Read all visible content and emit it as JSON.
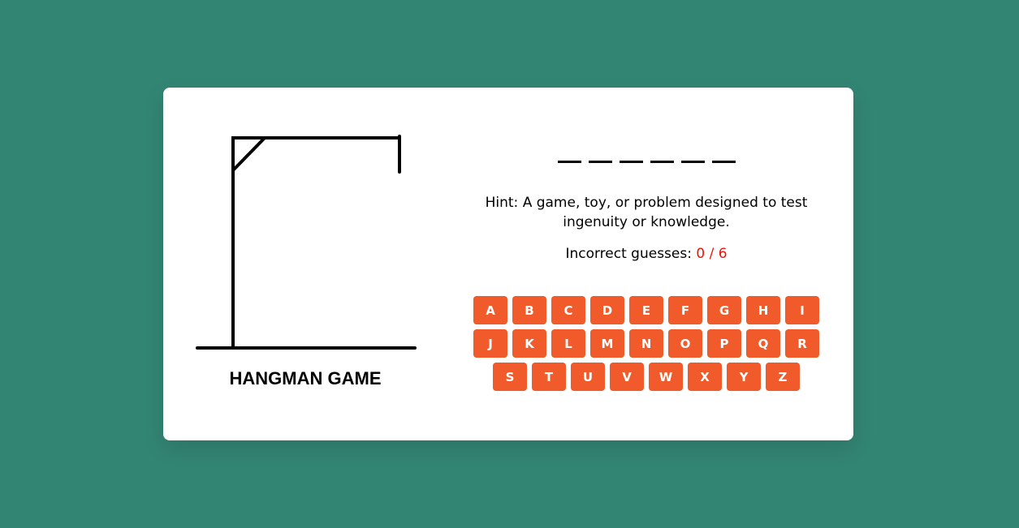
{
  "game": {
    "title": "HANGMAN GAME",
    "word_length": 6,
    "hint_label": "Hint:",
    "hint_text": "A game, toy, or problem designed to test ingenuity or knowledge.",
    "guesses_label": "Incorrect guesses:",
    "incorrect_count": "0 / 6"
  },
  "keyboard": {
    "rows": [
      [
        "A",
        "B",
        "C",
        "D",
        "E",
        "F",
        "G",
        "H",
        "I"
      ],
      [
        "J",
        "K",
        "L",
        "M",
        "N",
        "O",
        "P",
        "Q",
        "R"
      ],
      [
        "S",
        "T",
        "U",
        "V",
        "W",
        "X",
        "Y",
        "Z"
      ]
    ]
  },
  "colors": {
    "background": "#338573",
    "key": "#f15a2a",
    "incorrect_count": "#e3170a"
  }
}
